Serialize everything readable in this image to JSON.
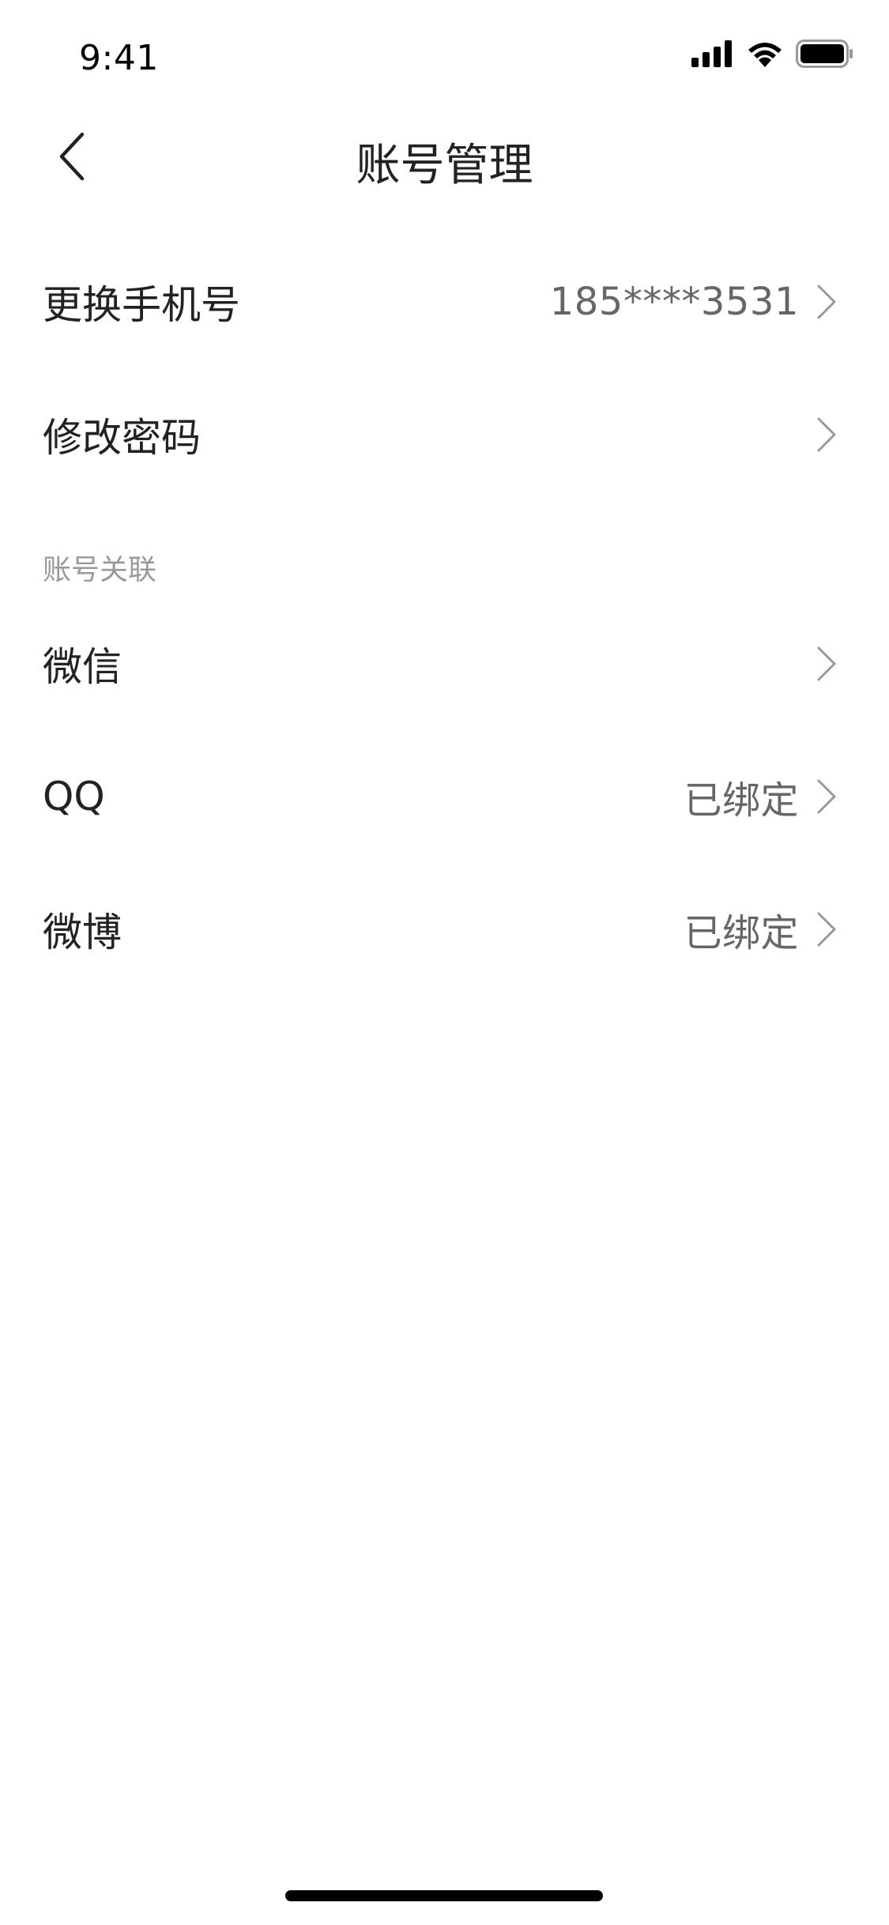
{
  "status_bar": {
    "time": "9:41",
    "icons": [
      "cellular-signal-icon",
      "wifi-icon",
      "battery-icon"
    ]
  },
  "nav": {
    "title": "账号管理",
    "back_icon": "chevron-left-icon"
  },
  "account": {
    "phone": {
      "label": "更换手机号",
      "value": "185****3531"
    },
    "password": {
      "label": "修改密码",
      "value": ""
    }
  },
  "linked": {
    "section_title": "账号关联",
    "items": [
      {
        "label": "微信",
        "value": ""
      },
      {
        "label": "QQ",
        "value": "已绑定"
      },
      {
        "label": "微博",
        "value": "已绑定"
      }
    ]
  },
  "colors": {
    "text_primary": "#222222",
    "text_secondary": "#666666",
    "section_header": "#999999",
    "chevron": "#999999",
    "background": "#ffffff"
  }
}
